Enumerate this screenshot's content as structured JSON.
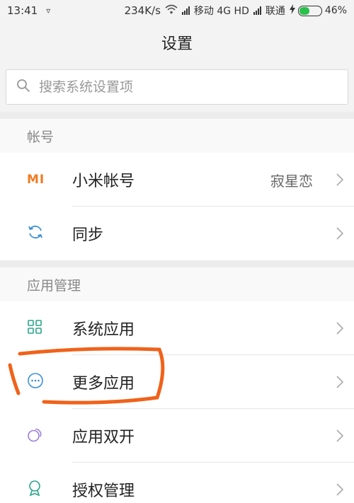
{
  "status_bar": {
    "time": "13:41",
    "notification_glyph": "▿",
    "speed": "234K/s",
    "carrier1": "移动 4G HD",
    "carrier2": "联通",
    "battery_percent": "46%",
    "battery_level": 0.46
  },
  "header": {
    "title": "设置"
  },
  "search": {
    "placeholder": "搜索系统设置项"
  },
  "account_section": {
    "title": "帐号",
    "items": [
      {
        "label": "小米帐号",
        "value": "寂星恋",
        "icon": "mi-logo-icon",
        "icon_text": "MI"
      },
      {
        "label": "同步",
        "icon": "sync-icon"
      }
    ]
  },
  "apps_section": {
    "title": "应用管理",
    "items": [
      {
        "label": "系统应用",
        "icon": "grid-icon"
      },
      {
        "label": "更多应用",
        "icon": "more-dots-icon"
      },
      {
        "label": "应用双开",
        "icon": "dual-apps-icon"
      },
      {
        "label": "授权管理",
        "icon": "badge-icon"
      }
    ]
  },
  "colors": {
    "accent_orange": "#f07b22",
    "icon_blue": "#3a8fd8",
    "icon_green": "#2aa58a",
    "icon_purple": "#9a7ed8",
    "annotation": "#f0621a"
  }
}
